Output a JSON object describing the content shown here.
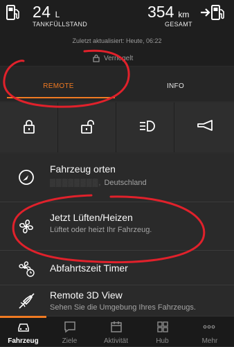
{
  "status": {
    "fuel_value": "24",
    "fuel_unit": "L",
    "fuel_label": "TANKFÜLLSTAND",
    "range_value": "354",
    "range_unit": "km",
    "range_label": "GESAMT",
    "updated": "Zuletzt aktualisiert: Heute, 06:22",
    "lock_state": "Verriegelt"
  },
  "tabs": [
    {
      "label": "REMOTE",
      "active": true
    },
    {
      "label": "INFO",
      "active": false
    }
  ],
  "actions": [
    {
      "name": "lock",
      "icon": "lock-closed-icon"
    },
    {
      "name": "unlock",
      "icon": "lock-open-icon"
    },
    {
      "name": "lights",
      "icon": "headlight-icon"
    },
    {
      "name": "horn",
      "icon": "horn-icon"
    }
  ],
  "list": [
    {
      "title": "Fahrzeug orten",
      "subtitle": "Deutschland",
      "icon": "locate-icon"
    },
    {
      "title": "Jetzt Lüften/Heizen",
      "subtitle": "Lüftet oder heizt Ihr Fahrzeug.",
      "icon": "fan-icon"
    },
    {
      "title": "Abfahrtszeit Timer",
      "subtitle": "",
      "icon": "fan-timer-icon"
    },
    {
      "title": "Remote 3D View",
      "subtitle": "Sehen Sie die Umgebung Ihres Fahrzeugs.",
      "icon": "rocket-icon"
    }
  ],
  "nav": [
    {
      "label": "Fahrzeug",
      "icon": "car-icon",
      "active": true
    },
    {
      "label": "Ziele",
      "icon": "chat-bubble-icon",
      "active": false
    },
    {
      "label": "Aktivität",
      "icon": "calendar-icon",
      "active": false
    },
    {
      "label": "Hub",
      "icon": "grid-icon",
      "active": false
    },
    {
      "label": "Mehr",
      "icon": "more-dots-icon",
      "active": false
    }
  ],
  "colors": {
    "accent": "#f07a22",
    "annotation": "#e0212b"
  }
}
